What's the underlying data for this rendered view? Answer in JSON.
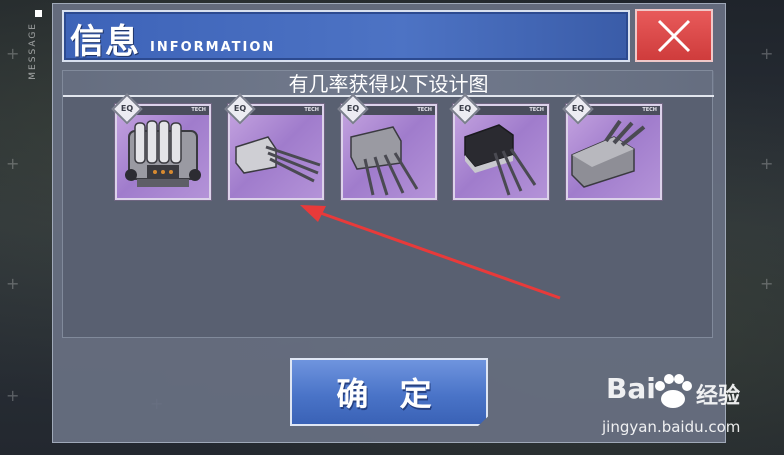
{
  "dialog": {
    "title": "信息",
    "title_sub": "INFORMATION",
    "subtitle": "有几率获得以下设计图",
    "confirm_label": "确 定"
  },
  "side_label": "MESSAGE",
  "cards": [
    {
      "icon": "armor-plate-blueprint-icon",
      "tag": "TECH"
    },
    {
      "icon": "triple-gun-turret-light-icon",
      "tag": "TECH"
    },
    {
      "icon": "quad-gun-turret-icon",
      "tag": "TECH"
    },
    {
      "icon": "triple-gun-turret-dark-icon",
      "tag": "TECH"
    },
    {
      "icon": "heavy-gun-turret-icon",
      "tag": "TECH"
    }
  ],
  "card_badge": "EQ",
  "watermark": {
    "brand": "Bai",
    "brand_cn": "经验",
    "url": "jingyan.baidu.com"
  },
  "colors": {
    "title_bar": "#4d73c4",
    "close_button": "#d94848",
    "card_bg": "#b08ad8",
    "confirm_button": "#4a74c8",
    "annotation_arrow": "#e83a3a"
  }
}
